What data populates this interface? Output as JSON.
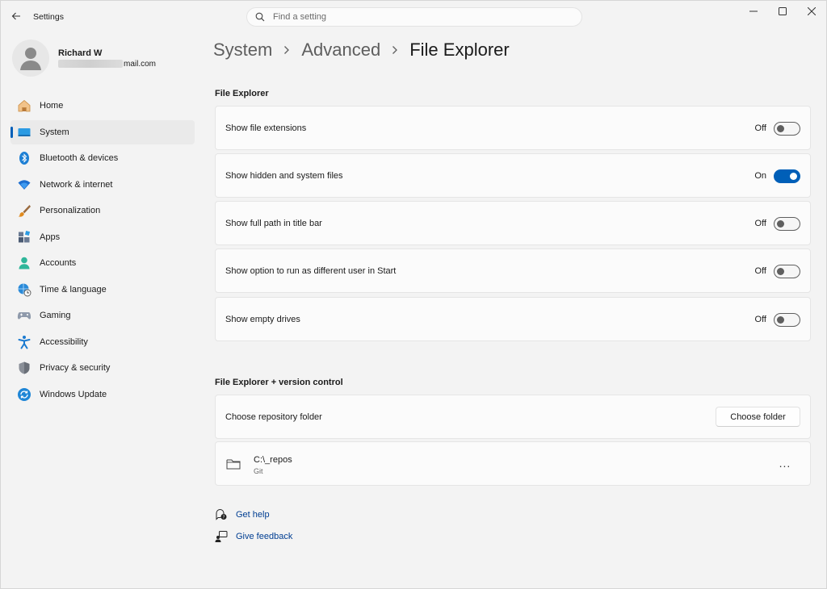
{
  "window": {
    "app_title": "Settings"
  },
  "search": {
    "placeholder": "Find a setting"
  },
  "profile": {
    "name": "Richard W",
    "email_suffix": "mail.com"
  },
  "sidebar": {
    "items": [
      {
        "label": "Home",
        "icon": "home-icon",
        "active": false
      },
      {
        "label": "System",
        "icon": "system-icon",
        "active": true
      },
      {
        "label": "Bluetooth & devices",
        "icon": "bluetooth-icon",
        "active": false
      },
      {
        "label": "Network & internet",
        "icon": "network-icon",
        "active": false
      },
      {
        "label": "Personalization",
        "icon": "brush-icon",
        "active": false
      },
      {
        "label": "Apps",
        "icon": "apps-icon",
        "active": false
      },
      {
        "label": "Accounts",
        "icon": "accounts-icon",
        "active": false
      },
      {
        "label": "Time & language",
        "icon": "globe-clock-icon",
        "active": false
      },
      {
        "label": "Gaming",
        "icon": "gamepad-icon",
        "active": false
      },
      {
        "label": "Accessibility",
        "icon": "accessibility-icon",
        "active": false
      },
      {
        "label": "Privacy & security",
        "icon": "shield-icon",
        "active": false
      },
      {
        "label": "Windows Update",
        "icon": "update-icon",
        "active": false
      }
    ]
  },
  "breadcrumb": {
    "items": [
      "System",
      "Advanced",
      "File Explorer"
    ]
  },
  "file_explorer": {
    "title": "File Explorer",
    "settings": [
      {
        "label": "Show file extensions",
        "state": "Off",
        "on": false
      },
      {
        "label": "Show hidden and system files",
        "state": "On",
        "on": true
      },
      {
        "label": "Show full path in title bar",
        "state": "Off",
        "on": false
      },
      {
        "label": "Show option to run as different user in Start",
        "state": "Off",
        "on": false
      },
      {
        "label": "Show empty drives",
        "state": "Off",
        "on": false
      }
    ]
  },
  "version_control": {
    "title": "File Explorer + version control",
    "choose_label": "Choose repository folder",
    "choose_button": "Choose folder",
    "repo": {
      "path": "C:\\_repos",
      "type": "Git",
      "more": "..."
    }
  },
  "links": {
    "help": "Get help",
    "feedback": "Give feedback"
  },
  "colors": {
    "accent": "#005fb8",
    "background": "#f3f3f3",
    "card": "#fbfbfb"
  }
}
